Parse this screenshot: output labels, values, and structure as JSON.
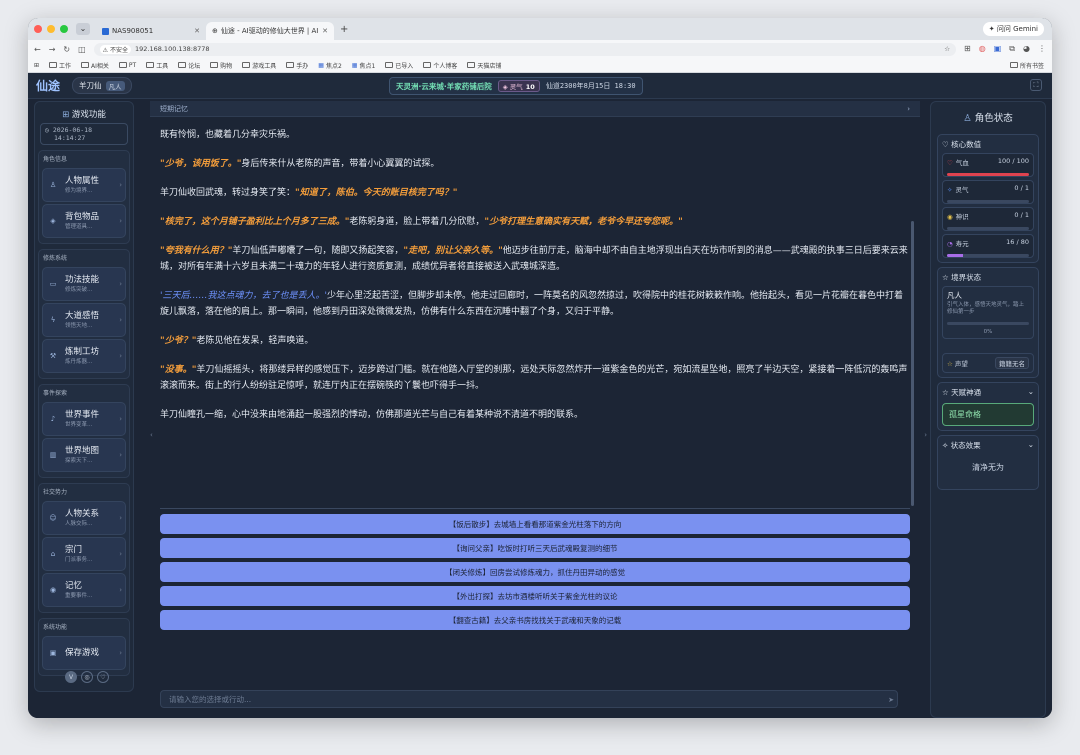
{
  "browser": {
    "tabs": [
      {
        "title": "NAS908051"
      },
      {
        "title": "仙途 - AI驱动的修仙大世界 | AI"
      }
    ],
    "gemini_label": "问问 Gemini",
    "security_label": "不安全",
    "url": "192.168.100.138:8778",
    "bookmarks": [
      "工作",
      "AI相关",
      "PT",
      "工具",
      "论坛",
      "购物",
      "游戏工具",
      "手办",
      "焦点2",
      "焦点1",
      "已导入",
      "个人博客",
      "天猫店铺"
    ],
    "all_bookmarks": "所有书签"
  },
  "topnav": {
    "logo": "仙途",
    "player_name": "羊刀仙",
    "player_rank": "凡人",
    "location": "天灵洲·云来城·羊家药铺后院",
    "qi_label": "灵气",
    "qi_value": "10",
    "datetime": "仙道2300年8月15日 18:30"
  },
  "left": {
    "title": "游戏功能",
    "clock": [
      "2026-06-18",
      "14:14:27"
    ],
    "groups": [
      {
        "title": "角色信息",
        "items": [
          {
            "title": "人物属性",
            "sub": "修为境界…",
            "icon": "person-icon",
            "glyph": "♙"
          },
          {
            "title": "背包物品",
            "sub": "管理道具…",
            "icon": "bag-icon",
            "glyph": "◈"
          }
        ]
      },
      {
        "title": "修炼系统",
        "items": [
          {
            "title": "功法技能",
            "sub": "修炼突破…",
            "icon": "book-icon",
            "glyph": "▭"
          },
          {
            "title": "大道感悟",
            "sub": "领悟天地…",
            "icon": "bolt-icon",
            "glyph": "ϟ"
          },
          {
            "title": "炼制工坊",
            "sub": "炼丹炼器…",
            "icon": "hammer-icon",
            "glyph": "⚒"
          }
        ]
      },
      {
        "title": "事件探索",
        "items": [
          {
            "title": "世界事件",
            "sub": "世界变革…",
            "icon": "bell-icon",
            "glyph": "♪"
          },
          {
            "title": "世界地图",
            "sub": "探索天下…",
            "icon": "map-icon",
            "glyph": "▥"
          }
        ]
      },
      {
        "title": "社交势力",
        "items": [
          {
            "title": "人物关系",
            "sub": "人脉交际…",
            "icon": "people-icon",
            "glyph": "☺"
          },
          {
            "title": "宗门",
            "sub": "门派事务…",
            "icon": "home-icon",
            "glyph": "⌂"
          },
          {
            "title": "记忆",
            "sub": "重要事件…",
            "icon": "memory-icon",
            "glyph": "◉"
          }
        ]
      },
      {
        "title": "系统功能",
        "items": [
          {
            "title": "保存游戏",
            "sub": "",
            "icon": "save-icon",
            "glyph": "▣"
          }
        ]
      }
    ]
  },
  "main": {
    "header": "短期记忆",
    "paragraphs": [
      [
        {
          "t": "既有怜悯，也藏着几分幸灾乐祸。",
          "s": ""
        }
      ],
      [
        {
          "t": "\"少爷，该用饭了。\"",
          "s": "q"
        },
        {
          "t": "身后传来什从老陈的声音，带着小心翼翼的试探。",
          "s": ""
        }
      ],
      [
        {
          "t": "羊刀仙收回武魂，转过身笑了笑：",
          "s": ""
        },
        {
          "t": "\"知道了，陈伯。今天的账目核完了吗？\"",
          "s": "q"
        }
      ],
      [
        {
          "t": "\"核完了，这个月铺子盈利比上个月多了三成。\"",
          "s": "q"
        },
        {
          "t": "老陈躬身道，脸上带着几分欣慰，",
          "s": ""
        },
        {
          "t": "\"少爷打理生意确实有天赋，老爷今早还夸您呢。\"",
          "s": "q"
        }
      ],
      [
        {
          "t": "\"夸我有什么用？\"",
          "s": "q"
        },
        {
          "t": "羊刀仙低声嘟囔了一句，随即又扬起笑容，",
          "s": ""
        },
        {
          "t": "\"走吧，别让父亲久等。\"",
          "s": "q"
        },
        {
          "t": "他迈步往前厅走，脑海中却不由自主地浮现出白天在坊市听到的消息——武魂殿的执事三日后要来云来城，对所有年满十六岁且未满二十魂力的年轻人进行资质复测，成绩优异者将直接被送入武魂城深造。",
          "s": ""
        }
      ],
      [
        {
          "t": "'三天后……我这点魂力，去了也是丢人。'",
          "s": "b"
        },
        {
          "t": "少年心里泛起苦涩，但脚步却未停。他走过回廊时，一阵莫名的风忽然掠过，吹得院中的桂花树簌簌作响。他抬起头，看见一片花瓣在暮色中打着旋儿飘落，落在他的肩上。那一瞬间，他感到丹田深处微微发热，仿佛有什么东西在沉睡中翻了个身，又归于平静。",
          "s": ""
        }
      ],
      [
        {
          "t": "\"少爷？\"",
          "s": "q"
        },
        {
          "t": "老陈见他在发呆，轻声唤道。",
          "s": ""
        }
      ],
      [
        {
          "t": "\"没事。\"",
          "s": "q"
        },
        {
          "t": "羊刀仙摇摇头，将那缕异样的感觉压下，迈步跨过门槛。就在他踏入厅堂的刹那，远处天际忽然炸开一道紫金色的光芒，宛如流星坠地，照亮了半边天空，紧接着一阵低沉的轰鸣声滚滚而来。街上的行人纷纷驻足惊呼，就连厅内正在摆碗筷的丫鬟也吓得手一抖。",
          "s": ""
        }
      ],
      [
        {
          "t": "羊刀仙瞳孔一缩，心中没来由地涌起一股强烈的悸动，仿佛那道光芒与自己有着某种说不清道不明的联系。",
          "s": ""
        }
      ]
    ],
    "choices": [
      "【饭后散步】去城墙上看看那道紫金光柱落下的方向",
      "【询问父亲】吃饭时打听三天后武魂殿复测的细节",
      "【闭关修炼】回房尝试修炼魂力，抓住丹田异动的感觉",
      "【外出打探】去坊市酒楼听听关于紫金光柱的议论",
      "【翻查古籍】去父亲书房找找关于武魂和天象的记载"
    ],
    "input_placeholder": "请输入您的选择或行动..."
  },
  "right": {
    "title": "角色状态",
    "core_title": "核心数值",
    "stats": [
      {
        "label": "气血",
        "value": "100 / 100",
        "fraction": 1.0,
        "color": "#e0434f",
        "icon": "heart-icon",
        "glyph": "♡"
      },
      {
        "label": "灵气",
        "value": "0 / 1",
        "fraction": 0,
        "color": "#5a8dee",
        "icon": "spirit-icon",
        "glyph": "✧"
      },
      {
        "label": "神识",
        "value": "0 / 1",
        "fraction": 0,
        "color": "#e3c04a",
        "icon": "mind-icon",
        "glyph": "◉"
      },
      {
        "label": "寿元",
        "value": "16 / 80",
        "fraction": 0.2,
        "color": "#a86de8",
        "icon": "lifespan-icon",
        "glyph": "◔"
      }
    ],
    "realm_title": "境界状态",
    "realm_name": "凡人",
    "realm_desc": "引气入体，感悟天地灵气，踏上修仙第一步",
    "realm_pct": "0%",
    "fame_label": "声望",
    "fame_value": "籍籍无名",
    "talent_title": "天赋神通",
    "talent": "孤星命格",
    "effect_title": "状态效果",
    "effect": "清净无为"
  }
}
